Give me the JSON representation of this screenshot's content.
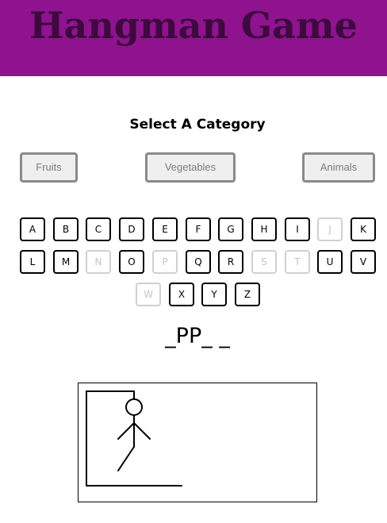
{
  "header": {
    "title": "Hangman Game",
    "background": "#8f128f",
    "title_color": "#3c0a3c"
  },
  "categories": {
    "heading": "Select A Category",
    "buttons": [
      "Fruits",
      "Vegetables",
      "Animals"
    ]
  },
  "keyboard": {
    "keys": [
      {
        "letter": "A",
        "used": false
      },
      {
        "letter": "B",
        "used": false
      },
      {
        "letter": "C",
        "used": false
      },
      {
        "letter": "D",
        "used": false
      },
      {
        "letter": "E",
        "used": false
      },
      {
        "letter": "F",
        "used": false
      },
      {
        "letter": "G",
        "used": false
      },
      {
        "letter": "H",
        "used": false
      },
      {
        "letter": "I",
        "used": false
      },
      {
        "letter": "J",
        "used": true
      },
      {
        "letter": "K",
        "used": false
      },
      {
        "letter": "L",
        "used": false
      },
      {
        "letter": "M",
        "used": false
      },
      {
        "letter": "N",
        "used": true
      },
      {
        "letter": "O",
        "used": false
      },
      {
        "letter": "P",
        "used": true
      },
      {
        "letter": "Q",
        "used": false
      },
      {
        "letter": "R",
        "used": false
      },
      {
        "letter": "S",
        "used": true
      },
      {
        "letter": "T",
        "used": true
      },
      {
        "letter": "U",
        "used": false
      },
      {
        "letter": "V",
        "used": false
      },
      {
        "letter": "W",
        "used": true
      },
      {
        "letter": "X",
        "used": false
      },
      {
        "letter": "Y",
        "used": false
      },
      {
        "letter": "Z",
        "used": false
      }
    ]
  },
  "word_display": "_PP_ _",
  "hangman": {
    "parts_drawn": [
      "gallows",
      "head",
      "body",
      "left-arm",
      "right-arm",
      "left-leg"
    ]
  }
}
